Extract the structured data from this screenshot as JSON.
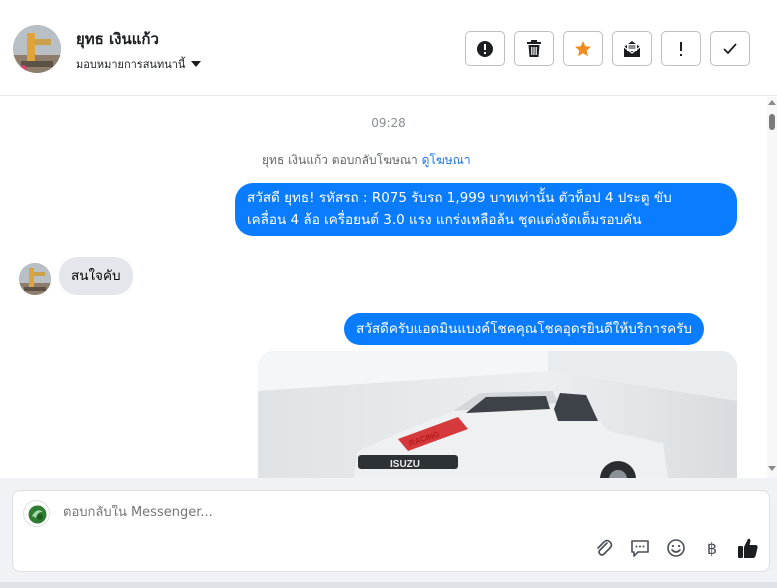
{
  "header": {
    "contact_name": "ยุทธ เงินแก้ว",
    "assign_label": "มอบหมายการสนทนานี้"
  },
  "actions": [
    {
      "name": "spam-button",
      "icon": "exclamation-circle-icon"
    },
    {
      "name": "delete-button",
      "icon": "trash-icon"
    },
    {
      "name": "star-button",
      "icon": "star-icon",
      "color": "#f28b1f"
    },
    {
      "name": "mark-unread-button",
      "icon": "envelope-open-icon"
    },
    {
      "name": "follow-up-button",
      "icon": "exclamation-icon"
    },
    {
      "name": "mark-done-button",
      "icon": "checkmark-icon"
    }
  ],
  "thread": {
    "timestamp": "09:28",
    "ad_note": "ยุทธ เงินแก้ว ตอบกลับโฆษณา",
    "ad_link": "ดูโฆษณา",
    "messages": [
      {
        "direction": "outgoing",
        "line1": "สวัสดี ยุทธ! รหัสรถ : R075 รับรถ 1,999 บาทเท่านั้น ตัวท็อป 4 ประตู ขับ",
        "line2": "เคลื่อน 4 ล้อ  เครื่อยนต์ 3.0 แรง แกร่งเหลือล้น ชุดแต่งจัดเต็มรอบคัน"
      },
      {
        "direction": "incoming",
        "text": "สนใจคับ"
      },
      {
        "direction": "outgoing",
        "text": "สวัสดีครับแอดมินแบงค์โชคคุณโชคอุดรยินดีให้บริการครับ"
      }
    ],
    "photo_plate": "ISUZU",
    "photo_decal": "RACING"
  },
  "composer": {
    "placeholder": "ตอบกลับใน Messenger...",
    "tools": [
      "paperclip-icon",
      "saved-reply-icon",
      "emoji-icon",
      "baht-icon",
      "thumbs-up-icon"
    ],
    "baht_symbol": "฿"
  },
  "colors": {
    "outgoing_bubble": "#0a7cff",
    "incoming_bubble": "#e4e6eb",
    "link": "#1877f2",
    "star": "#f28b1f"
  }
}
